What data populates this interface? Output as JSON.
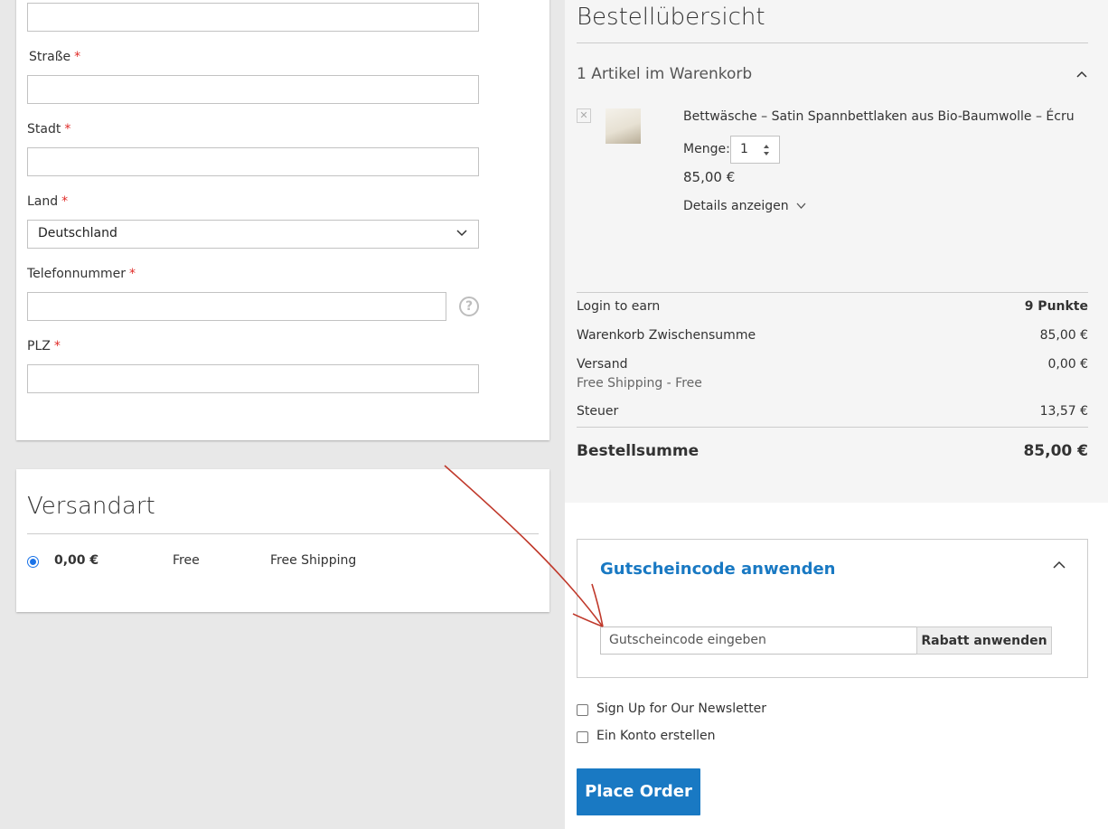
{
  "address_form": {
    "street_label": "Straße",
    "city_label": "Stadt",
    "country_label": "Land",
    "country_value": "Deutschland",
    "phone_label": "Telefonnummer",
    "zip_label": "PLZ",
    "required_marker": "*"
  },
  "shipping_method": {
    "title": "Versandart",
    "options": [
      {
        "price": "0,00 €",
        "method": "Free",
        "carrier": "Free Shipping",
        "selected": true
      }
    ]
  },
  "summary": {
    "title": "Bestellübersicht",
    "cart_count_text": "1 Artikel im Warenkorb",
    "item": {
      "name": "Bettwäsche – Satin Spannbettlaken aus Bio-Baumwolle – Écru",
      "qty_label": "Menge:",
      "qty_value": "1",
      "price": "85,00 €",
      "details_link": "Details anzeigen"
    },
    "totals": {
      "points_label": "Login to earn",
      "points_value": "9 Punkte",
      "subtotal_label": "Warenkorb Zwischensumme",
      "subtotal_value": "85,00 €",
      "shipping_label": "Versand",
      "shipping_sublabel": "Free Shipping - Free",
      "shipping_value": "0,00 €",
      "tax_label": "Steuer",
      "tax_value": "13,57 €",
      "grand_total_label": "Bestellsumme",
      "grand_total_value": "85,00 €"
    }
  },
  "coupon": {
    "title": "Gutscheincode anwenden",
    "placeholder": "Gutscheincode eingeben",
    "apply_label": "Rabatt anwenden"
  },
  "options": {
    "newsletter_label": "Sign Up for Our Newsletter",
    "create_account_label": "Ein Konto erstellen"
  },
  "place_order_label": "Place Order",
  "colors": {
    "primary": "#1979c3",
    "required": "#e02b27",
    "annotation_arrow": "#c0392b"
  }
}
